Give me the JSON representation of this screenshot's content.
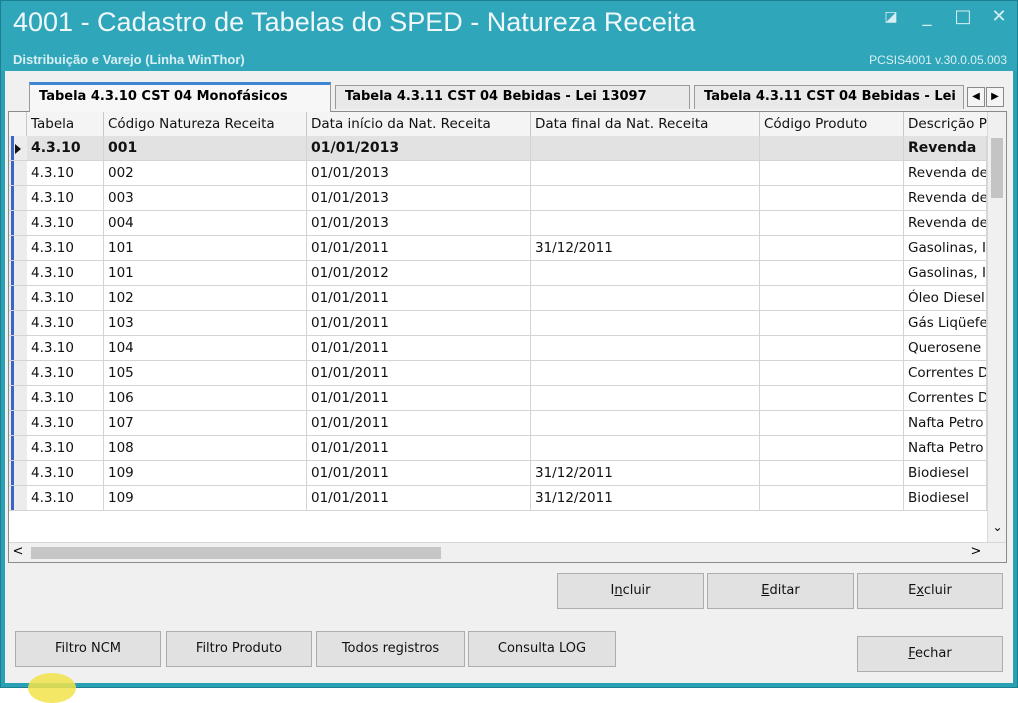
{
  "window": {
    "title": "4001 - Cadastro de Tabelas do SPED - Natureza Receita",
    "subtitle": "Distribuição e Varejo (Linha WinThor)",
    "version": "PCSIS4001  v.30.0.05.003",
    "buttons": {
      "restore": "◪",
      "minimize": "_",
      "maximize": "□",
      "close": "✕"
    }
  },
  "tabs": [
    {
      "label": "Tabela 4.3.10 CST 04 Monofásicos",
      "active": true
    },
    {
      "label": "Tabela 4.3.11 CST 04 Bebidas - Lei 13097",
      "active": false
    },
    {
      "label": "Tabela 4.3.11 CST 04 Bebidas - Lei",
      "active": false
    }
  ],
  "tab_scroll": {
    "left": "◀",
    "right": "▶"
  },
  "grid": {
    "columns": [
      "Tabela",
      "Código Natureza Receita",
      "Data início da Nat. Receita",
      "Data final da Nat. Receita",
      "Código Produto",
      "Descrição P"
    ],
    "rows": [
      [
        "4.3.10",
        "001",
        "01/01/2013",
        "",
        "",
        "Revenda"
      ],
      [
        "4.3.10",
        "002",
        "01/01/2013",
        "",
        "",
        "Revenda de"
      ],
      [
        "4.3.10",
        "003",
        "01/01/2013",
        "",
        "",
        "Revenda de"
      ],
      [
        "4.3.10",
        "004",
        "01/01/2013",
        "",
        "",
        "Revenda de"
      ],
      [
        "4.3.10",
        "101",
        "01/01/2011",
        "31/12/2011",
        "",
        "Gasolinas, I"
      ],
      [
        "4.3.10",
        "101",
        "01/01/2012",
        "",
        "",
        "Gasolinas, I"
      ],
      [
        "4.3.10",
        "102",
        "01/01/2011",
        "",
        "",
        "Óleo Diesel"
      ],
      [
        "4.3.10",
        "103",
        "01/01/2011",
        "",
        "",
        "Gás Liqüefe"
      ],
      [
        "4.3.10",
        "104",
        "01/01/2011",
        "",
        "",
        "Querosene"
      ],
      [
        "4.3.10",
        "105",
        "01/01/2011",
        "",
        "",
        "Correntes D"
      ],
      [
        "4.3.10",
        "106",
        "01/01/2011",
        "",
        "",
        "Correntes D"
      ],
      [
        "4.3.10",
        "107",
        "01/01/2011",
        "",
        "",
        "Nafta Petro"
      ],
      [
        "4.3.10",
        "108",
        "01/01/2011",
        "",
        "",
        "Nafta Petro"
      ],
      [
        "4.3.10",
        "109",
        "01/01/2011",
        "31/12/2011",
        "",
        "Biodiesel"
      ],
      [
        "4.3.10",
        "109",
        "01/01/2011",
        "31/12/2011",
        "",
        "Biodiesel"
      ]
    ],
    "scroll": {
      "down": "⌄",
      "left": "<",
      "right": ">"
    }
  },
  "actions": {
    "incluir": {
      "pre": "I",
      "key": "n",
      "post": "cluir"
    },
    "editar": {
      "pre": "",
      "key": "E",
      "post": "ditar"
    },
    "excluir": {
      "pre": "E",
      "key": "x",
      "post": "cluir"
    },
    "fechar": {
      "pre": "",
      "key": "F",
      "post": "echar"
    }
  },
  "filters": {
    "filtro_ncm": "Filtro NCM",
    "filtro_produto": "Filtro Produto",
    "todos_registros": "Todos registros",
    "consulta_log": "Consulta LOG"
  },
  "colors": {
    "titlebar": "#2fa6ba",
    "active_tab_accent": "#3d86d4",
    "row_selector": "#3b63c8"
  }
}
